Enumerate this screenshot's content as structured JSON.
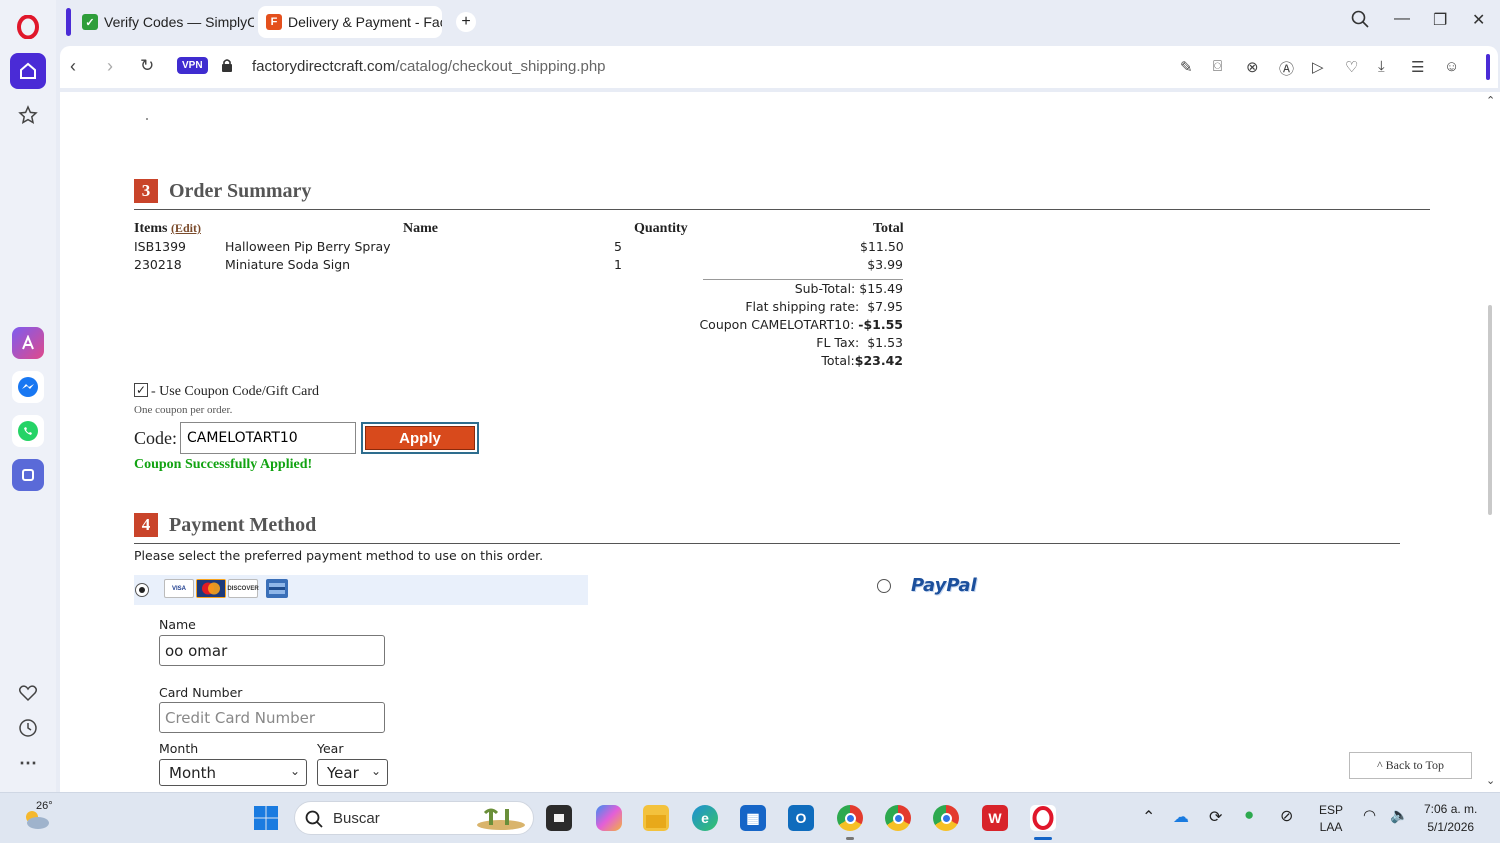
{
  "browser": {
    "tabs": [
      {
        "label": "Verify Codes — SimplyCo",
        "favicon_color": "#2e9d3a"
      },
      {
        "label": "Delivery & Payment - Fact",
        "favicon": "F",
        "favicon_color": "#e4501d"
      }
    ],
    "vpn_label": "VPN",
    "url_host": "factorydirectcraft.com",
    "url_path": "/catalog/checkout_shipping.php"
  },
  "order_summary": {
    "number": "3",
    "title": "Order Summary",
    "headers": {
      "items": "Items",
      "edit": "(Edit)",
      "name": "Name",
      "quantity": "Quantity",
      "total": "Total"
    },
    "rows": [
      {
        "sku": "ISB1399",
        "name": "Halloween Pip Berry Spray",
        "qty": "5",
        "total": "$11.50"
      },
      {
        "sku": "230218",
        "name": "Miniature Soda Sign",
        "qty": "1",
        "total": "$3.99"
      }
    ],
    "totals": [
      {
        "label": "Sub-Total:",
        "value": "$15.49",
        "bold": false
      },
      {
        "label": "Flat shipping rate:",
        "value": "$7.95",
        "bold": false
      },
      {
        "label": "Coupon CAMELOTART10:",
        "value": "-$1.55",
        "bold": true
      },
      {
        "label": "FL Tax:",
        "value": "$1.53",
        "bold": false
      },
      {
        "label": "Total:",
        "value": "$23.42",
        "bold": true
      }
    ]
  },
  "coupon": {
    "checkbox_label": "- Use Coupon Code/Gift Card",
    "note": "One coupon per order.",
    "code_label": "Code:",
    "code_value": "CAMELOTART10",
    "apply_label": "Apply",
    "success": "Coupon Successfully Applied!"
  },
  "payment": {
    "number": "4",
    "title": "Payment Method",
    "instruction": "Please select the preferred payment method to use on this order.",
    "paypal_label": "PayPal",
    "name_label": "Name",
    "name_value": "oo omar",
    "card_label": "Card Number",
    "card_placeholder": "Credit Card Number",
    "month_label": "Month",
    "month_value": "Month",
    "year_label": "Year",
    "year_value": "Year"
  },
  "back_to_top": "^ Back to Top",
  "taskbar": {
    "weather_temp": "26°",
    "search_placeholder": "Buscar",
    "lang_top": "ESP",
    "lang_bottom": "LAA",
    "time": "7:06 a. m.",
    "date": "5/1/2026"
  }
}
